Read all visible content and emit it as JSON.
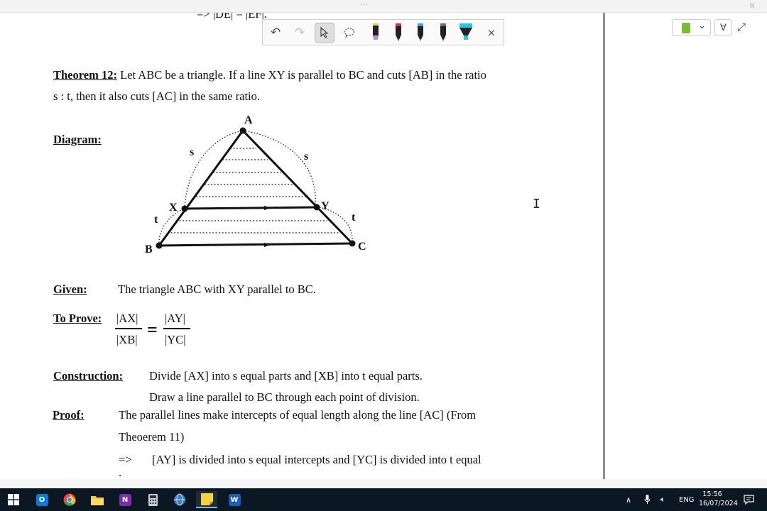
{
  "document": {
    "top_partial_line": "=> |DE| = |EF|.",
    "theorem_label": "Theorem 12:",
    "theorem_line1": "Let ABC be a triangle. If a line XY is parallel to BC and cuts [AB] in the ratio",
    "theorem_line2": "s : t, then it also cuts [AC] in the same ratio.",
    "diagram_label": "Diagram:",
    "diagram_labels": {
      "A": "A",
      "B": "B",
      "C": "C",
      "X": "X",
      "Y": "Y",
      "s_left": "s",
      "s_right": "s",
      "t_left": "t",
      "t_right": "t"
    },
    "given_label": "Given:",
    "given_text": "The triangle ABC with XY parallel to BC.",
    "to_prove_label": "To Prove:",
    "fraction_left_num": "|AX|",
    "fraction_left_den": "|XB|",
    "equals": "=",
    "fraction_right_num": "|AY|",
    "fraction_right_den": "|YC|",
    "construction_label": "Construction:",
    "construction_line1": "Divide [AX] into s equal parts and [XB] into t equal parts.",
    "construction_line2": "Draw a line parallel to BC through each point of division.",
    "proof_label": "Proof:",
    "proof_line1": "The parallel lines make intercepts of equal length along the line [AC]  (From",
    "proof_line2": "Theoerem 11)",
    "proof_arrow": "=>",
    "proof_line3": "[AY] is divided into s equal intercepts and [YC] is divided into t equal",
    "proof_line4_partial": "."
  },
  "ink_toolbar": {
    "undo_icon": "undo-icon",
    "redo_icon": "redo-icon",
    "select_icon": "cursor-arrow-icon",
    "lasso_icon": "lasso-icon",
    "pens": [
      {
        "name": "pen-yellow-purple",
        "color": "#f2c94c",
        "tip": "#b48fd6"
      },
      {
        "name": "pen-red",
        "color": "#222222",
        "tip": "#e03030"
      },
      {
        "name": "pen-blue",
        "color": "#222222",
        "tip": "#3aa0e8"
      },
      {
        "name": "pen-dark",
        "color": "#222222",
        "tip": "#555555"
      },
      {
        "name": "highlighter-cyan",
        "color": "#222222",
        "tip": "#27c5e6"
      }
    ],
    "close_label": "×"
  },
  "right_pane": {
    "notebook_color": "#7cba3a",
    "dropdown_caret": "⌄",
    "filter_symbol": "∀",
    "expand_symbol": "⤢",
    "text_cursor": "I"
  },
  "taskbar": {
    "apps": [
      "windows-start",
      "outlook",
      "chrome",
      "file-explorer",
      "onenote",
      "calculator",
      "browser",
      "sticky-notes",
      "word"
    ],
    "active_app": "sticky-notes",
    "language": "ENG",
    "time": "15:56",
    "date": "16/07/2024"
  }
}
